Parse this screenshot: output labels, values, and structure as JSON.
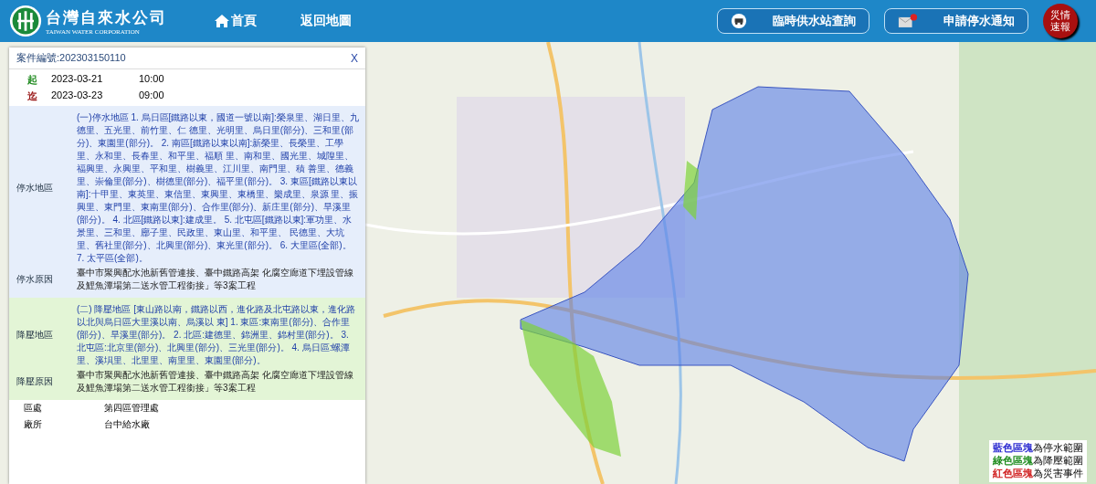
{
  "header": {
    "logo_title": "台灣自來水公司",
    "logo_subtitle": "TAIWAN WATER CORPORATION",
    "nav": [
      {
        "label": "首頁",
        "kind": "home"
      },
      {
        "label": "返回地圖",
        "kind": "plain"
      }
    ],
    "actions": [
      {
        "label": "臨時供水站查詢",
        "kind": "station"
      },
      {
        "label": "申請停水通知",
        "kind": "mail"
      }
    ],
    "alert": [
      "災情",
      "速報"
    ]
  },
  "panel": {
    "case_number": "案件編號:202303150110",
    "close": "X",
    "times": [
      {
        "label": "起",
        "date": "2023-03-21",
        "time": "10:00",
        "color": "#1f8a1f"
      },
      {
        "label": "迄",
        "date": "2023-03-23",
        "time": "09:00",
        "color": "#9b1c1c"
      }
    ],
    "sections": [
      {
        "kind": "outage",
        "rows": [
          {
            "label": "停水地區",
            "kind": "area",
            "text": "(一)停水地區 1. 烏日區[鐵路以東，國道一號以南]:榮泉里、湖日里、九德里、五光里、前竹里、仁 德里、光明里、烏日里(部分)、三和里(部分)、東園里(部分)。 2. 南區[鐵路以東以南]:新榮里、長榮里、工學里、永和里、長春里、和平里、福順 里、南和里、國光里、城隍里、福興里、永興里、平和里、樹義里、江川里、南門里、積 善里、德義里、崇倫里(部分)、樹德里(部分)、福平里(部分)。 3. 東區[鐵路以東以南]:十甲里、東英里、東信里、東興里、東橋里、樂成里、泉源 里、振興里、東門里、東南里(部分)、合作里(部分)、新庄里(部分)、旱溪里(部分)。 4. 北區[鐵路以東]:建成里。 5. 北屯區[鐵路以東]:軍功里、水景里、三和里、廍子里、民政里、東山里、和平里、 民德里、大坑里、舊社里(部分)、北興里(部分)、東光里(部分)。 6. 大里區(全部)。 7. 太平區(全部)。"
          },
          {
            "label": "停水原因",
            "kind": "reason",
            "text": "臺中市聚興配水池新舊管連接、臺中鐵路高架 化腐空廊道下埋設管線及鯉魚潭場第二送水管工程銜接」等3案工程"
          }
        ]
      },
      {
        "kind": "pressure",
        "rows": [
          {
            "label": "降壓地區",
            "kind": "area",
            "text": "(二) 降壓地區 [東山路以南，鐵路以西，進化路及北屯路以東，進化路以北與烏日區大里溪以南、烏溪以 東] 1. 東區:東南里(部分)、合作里(部分)、旱溪里(部分)。 2. 北區:建德里、錦洲里、錦村里(部分)。 3. 北屯區:北京里(部分)、北興里(部分)、三光里(部分)。 4. 烏日區:螺潭里、溪埧里、北里里、南里里、東園里(部分)。"
          },
          {
            "label": "降壓原因",
            "kind": "reason",
            "text": "臺中市聚興配水池新舊管連接、臺中鐵路高架 化腐空廊道下埋設管線及鯉魚潭場第二送水管工程銜接」等3案工程"
          }
        ]
      }
    ],
    "info": [
      {
        "label": "區處",
        "value": "第四區管理處"
      },
      {
        "label": "廠所",
        "value": "台中給水廠"
      }
    ]
  },
  "legend": [
    {
      "swatch": "藍色區塊",
      "color": "#2a2ad0",
      "text": "為停水範圍"
    },
    {
      "swatch": "綠色區塊",
      "color": "#1e8c1e",
      "text": "為降壓範圍"
    },
    {
      "swatch": "紅色區塊",
      "color": "#d02020",
      "text": "為災害事件"
    }
  ]
}
